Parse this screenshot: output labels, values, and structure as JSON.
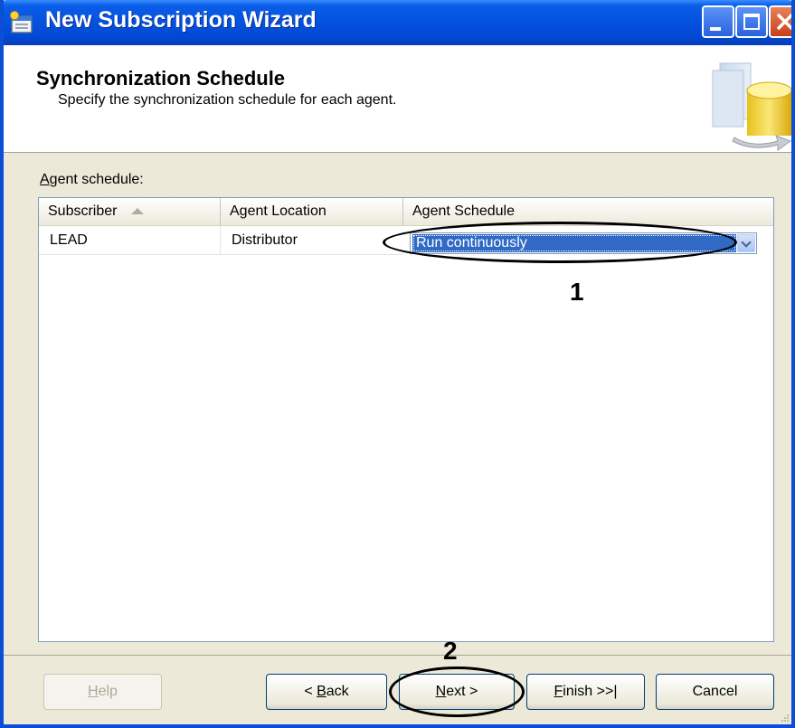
{
  "window": {
    "title": "New Subscription Wizard",
    "controls": [
      "minimize-icon",
      "maximize-icon",
      "close-icon"
    ]
  },
  "header": {
    "title": "Synchronization Schedule",
    "subtitle": "Specify the synchronization schedule for each agent."
  },
  "agent_schedule": {
    "label_accel": "A",
    "label_rest": "gent schedule:",
    "columns": [
      "Subscriber",
      "Agent Location",
      "Agent Schedule"
    ],
    "sorted_column": "Subscriber",
    "rows": [
      {
        "subscriber": "LEAD",
        "location": "Distributor",
        "schedule": "Run continuously"
      }
    ]
  },
  "callouts": {
    "one": "1",
    "two": "2"
  },
  "buttons": {
    "help": {
      "accel": "H",
      "rest": "elp",
      "enabled": false
    },
    "back": {
      "prefix": "< ",
      "accel": "B",
      "rest": "ack"
    },
    "next": {
      "accel": "N",
      "rest": "ext >"
    },
    "finish": {
      "accel": "F",
      "rest": "inish >>|"
    },
    "cancel": "Cancel"
  },
  "colors": {
    "titlebar": "#0551e0",
    "selection": "#316ac5",
    "dialog_bg": "#ece9d8"
  }
}
